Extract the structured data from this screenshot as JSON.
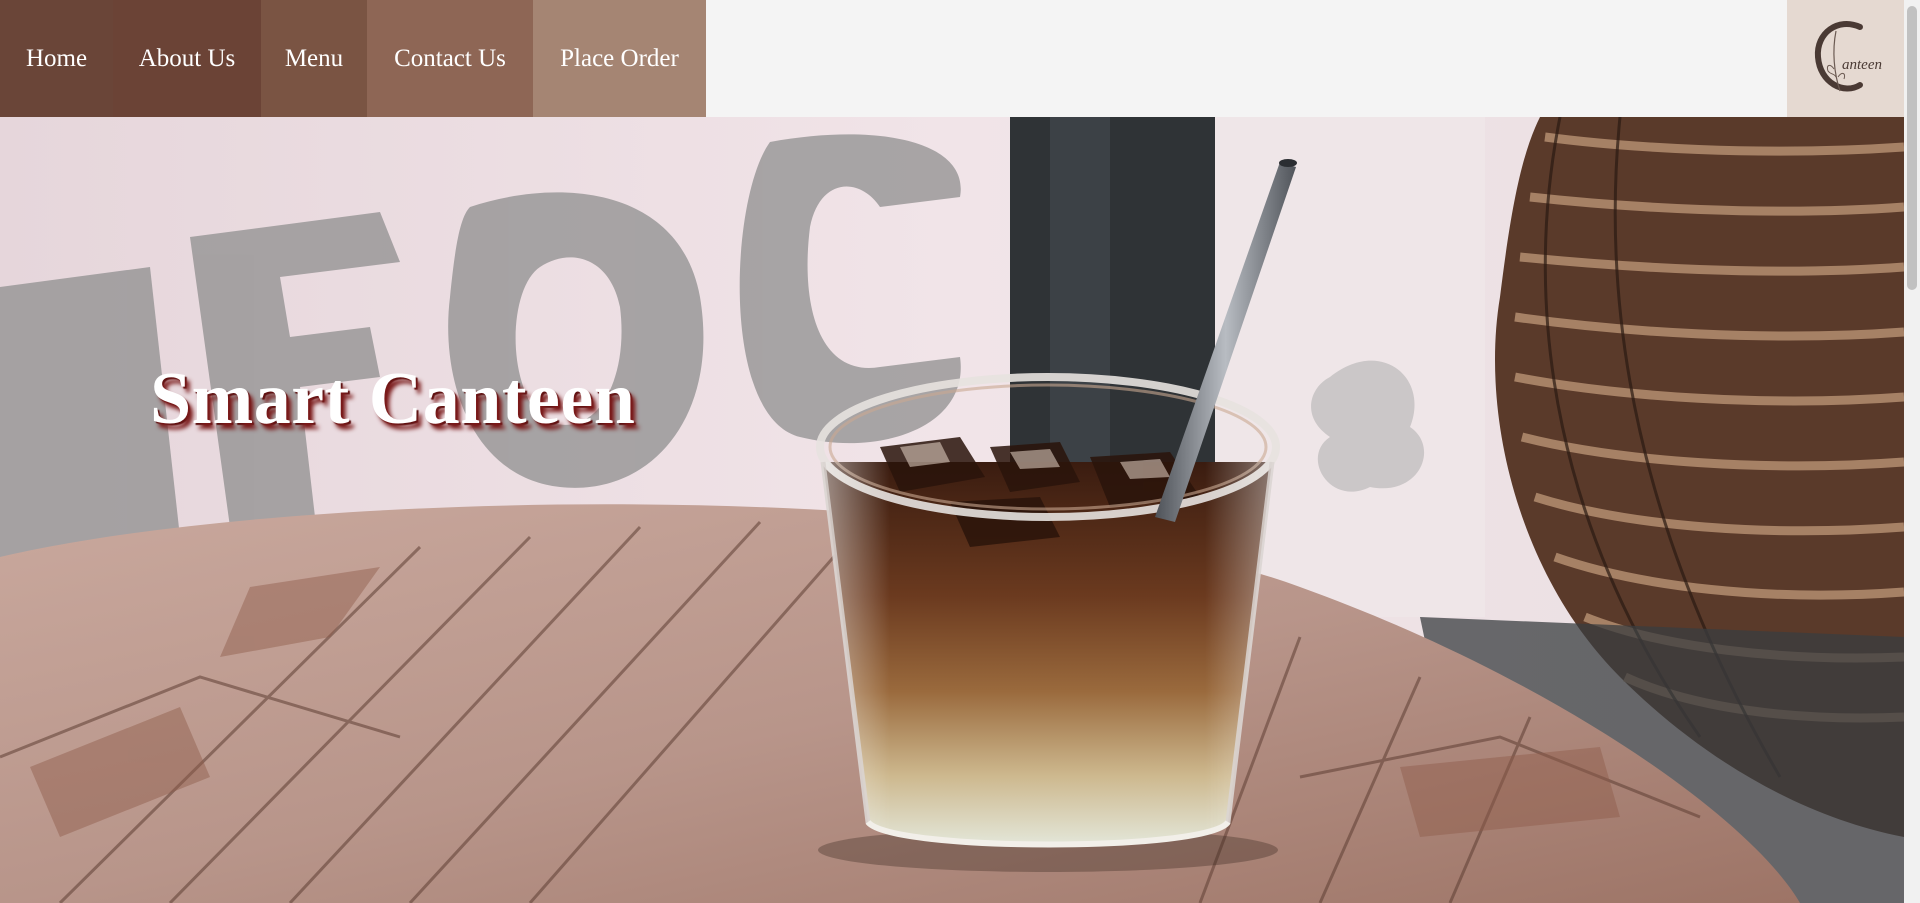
{
  "nav": {
    "items": [
      {
        "label": "Home"
      },
      {
        "label": "About Us"
      },
      {
        "label": "Menu"
      },
      {
        "label": "Contact Us"
      },
      {
        "label": "Place Order"
      }
    ]
  },
  "logo": {
    "text": "Canteen",
    "icon": "canteen-logo-icon"
  },
  "hero": {
    "title": "Smart Canteen",
    "image": "iced-coffee-on-wooden-table-image"
  },
  "colors": {
    "nav_home": "#6a4538",
    "nav_about": "#6b4336",
    "nav_menu": "#7a5443",
    "nav_contact": "#8e6655",
    "nav_order": "#a58573",
    "logo_bg": "#e5d9d1",
    "title_shadow": "#7a1a1a"
  }
}
